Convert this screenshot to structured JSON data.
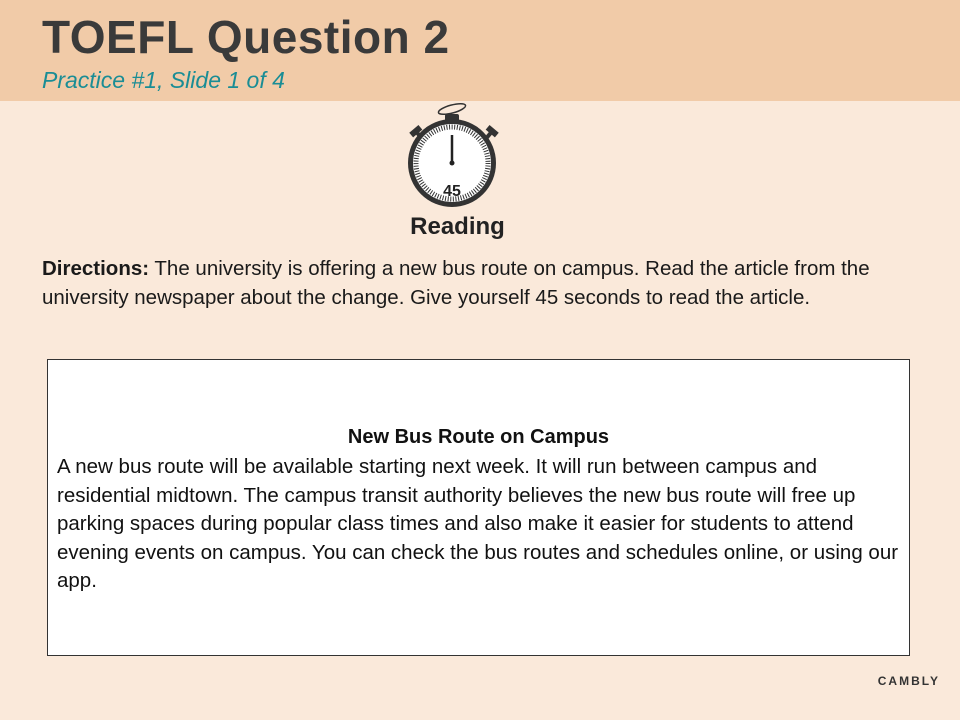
{
  "header": {
    "title": "TOEFL Question 2",
    "subtitle": "Practice #1, Slide 1 of 4"
  },
  "timer": {
    "icon": "stopwatch-icon",
    "seconds_label": "45",
    "label": "Reading"
  },
  "directions": {
    "lead": "Directions:",
    "text": " The university is offering a new bus route on campus. Read the article from the university newspaper about the change. Give yourself 45 seconds to read the article."
  },
  "article": {
    "title": "New Bus Route on Campus",
    "body": "A new bus route will be available starting next week. It will run between campus and residential midtown. The campus transit authority believes the new bus route will free up parking spaces during popular class times and also make it easier for students to attend evening events on campus. You can check the bus routes and schedules online, or using our app."
  },
  "brand": "CAMBLY",
  "colors": {
    "background": "#fae9da",
    "header_band": "#f1cba8",
    "title_text": "#3a3a3a",
    "subtitle_text": "#1a8d95"
  }
}
